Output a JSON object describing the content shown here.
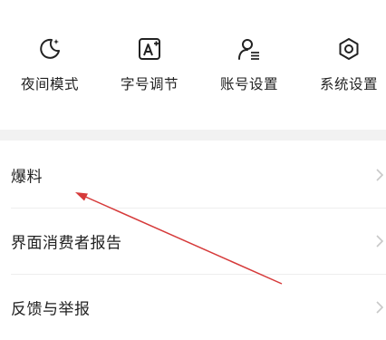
{
  "quick_actions": [
    {
      "label": "夜间模式",
      "icon": "night-mode-icon"
    },
    {
      "label": "字号调节",
      "icon": "font-size-icon"
    },
    {
      "label": "账号设置",
      "icon": "account-icon"
    },
    {
      "label": "系统设置",
      "icon": "settings-icon"
    }
  ],
  "menu": [
    {
      "label": "爆料"
    },
    {
      "label": "界面消费者报告"
    },
    {
      "label": "反馈与举报"
    }
  ],
  "colors": {
    "annotation_arrow": "#d63a3a",
    "chevron": "#c8c8c8",
    "section_gap": "#f2f2f2"
  }
}
